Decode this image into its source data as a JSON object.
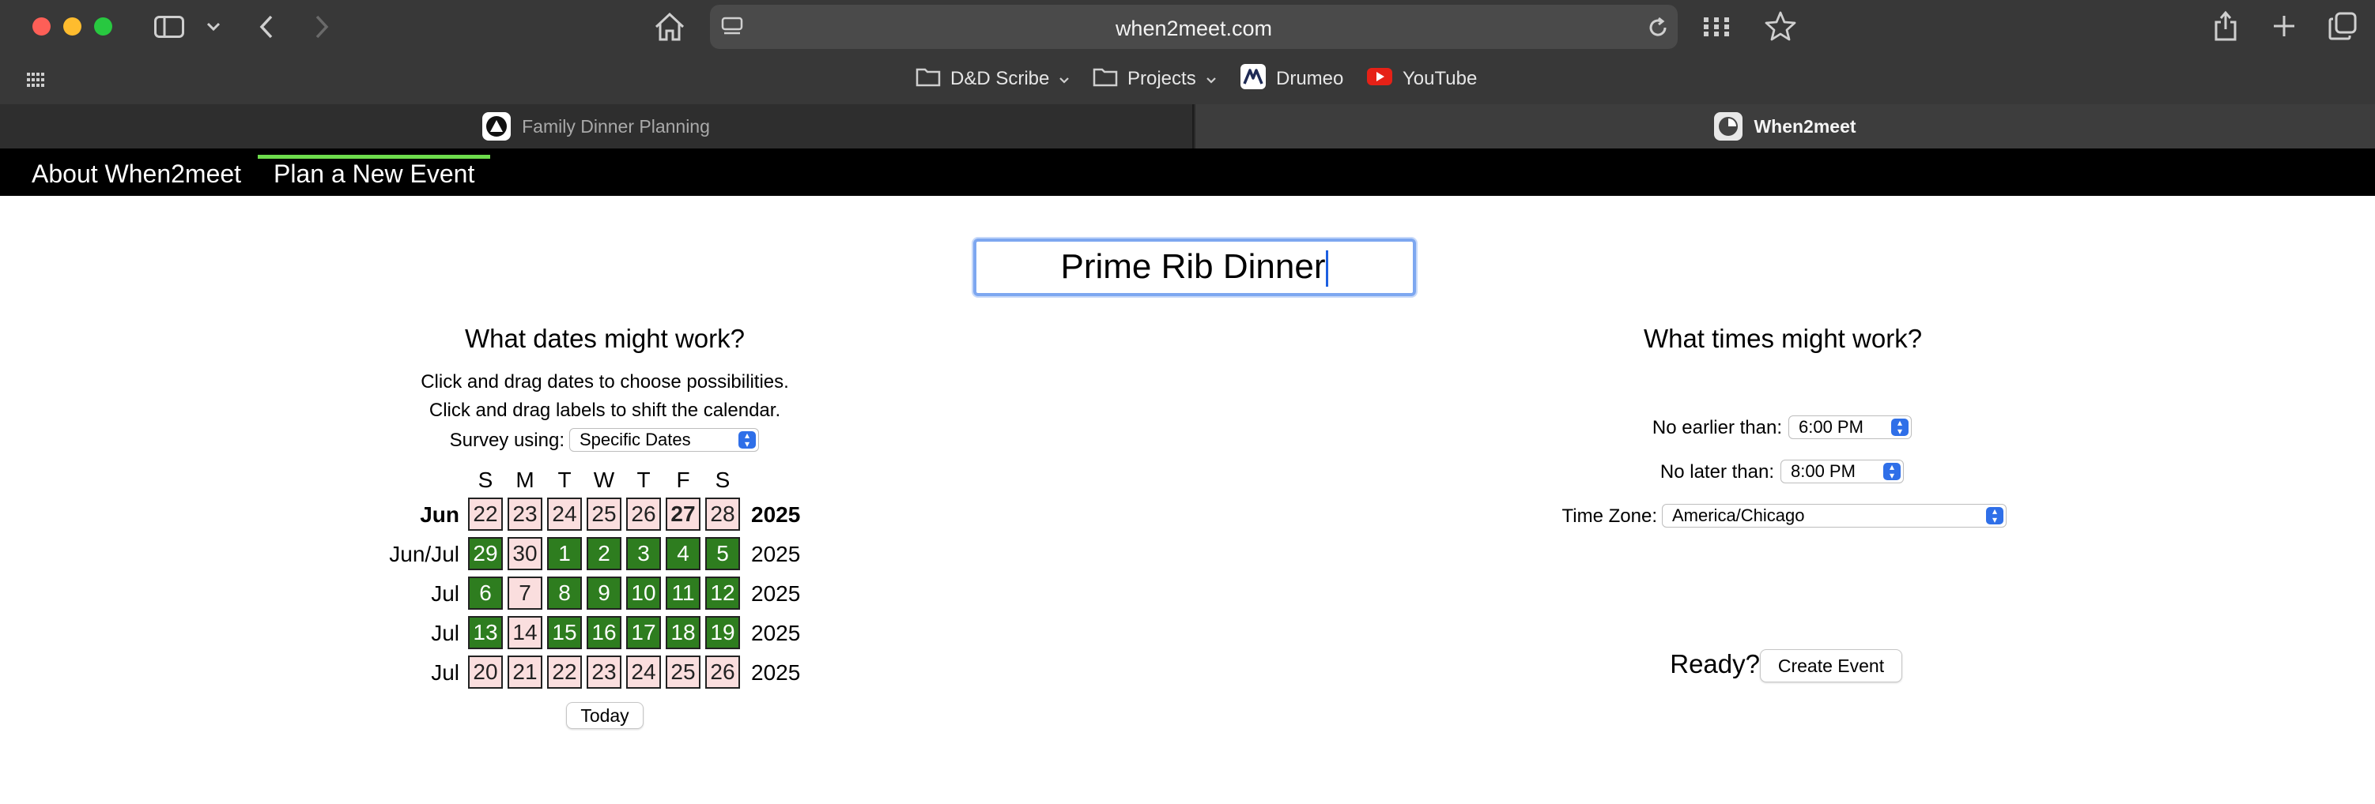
{
  "browser": {
    "url": "when2meet.com",
    "favorites": [
      {
        "label": "D&D Scribe",
        "icon": "folder-icon"
      },
      {
        "label": "Projects",
        "icon": "folder-icon"
      },
      {
        "label": "Drumeo",
        "icon": "drumeo-icon"
      },
      {
        "label": "YouTube",
        "icon": "youtube-icon"
      }
    ],
    "tabs": [
      {
        "label": "Family Dinner Planning",
        "active": false
      },
      {
        "label": "When2meet",
        "active": true
      }
    ]
  },
  "site_nav": {
    "about": "About When2meet",
    "plan": "Plan a New Event"
  },
  "event": {
    "name": "Prime Rib Dinner"
  },
  "dates_panel": {
    "heading": "What dates might work?",
    "instruction_1": "Click and drag dates to choose possibilities.",
    "instruction_2": "Click and drag labels to shift the calendar.",
    "survey_label": "Survey using:",
    "survey_value": "Specific Dates",
    "weekdays": [
      "S",
      "M",
      "T",
      "W",
      "T",
      "F",
      "S"
    ],
    "today_button": "Today",
    "rows": [
      {
        "label": "Jun",
        "year": "2025",
        "bold": true,
        "days": [
          {
            "d": "22",
            "sel": false
          },
          {
            "d": "23",
            "sel": false
          },
          {
            "d": "24",
            "sel": false
          },
          {
            "d": "25",
            "sel": false
          },
          {
            "d": "26",
            "sel": false
          },
          {
            "d": "27",
            "sel": false,
            "today": true
          },
          {
            "d": "28",
            "sel": false
          }
        ]
      },
      {
        "label": "Jun/Jul",
        "year": "2025",
        "bold": false,
        "days": [
          {
            "d": "29",
            "sel": true
          },
          {
            "d": "30",
            "sel": false
          },
          {
            "d": "1",
            "sel": true
          },
          {
            "d": "2",
            "sel": true
          },
          {
            "d": "3",
            "sel": true
          },
          {
            "d": "4",
            "sel": true
          },
          {
            "d": "5",
            "sel": true
          }
        ]
      },
      {
        "label": "Jul",
        "year": "2025",
        "bold": false,
        "days": [
          {
            "d": "6",
            "sel": true
          },
          {
            "d": "7",
            "sel": false
          },
          {
            "d": "8",
            "sel": true
          },
          {
            "d": "9",
            "sel": true
          },
          {
            "d": "10",
            "sel": true
          },
          {
            "d": "11",
            "sel": true
          },
          {
            "d": "12",
            "sel": true
          }
        ]
      },
      {
        "label": "Jul",
        "year": "2025",
        "bold": false,
        "days": [
          {
            "d": "13",
            "sel": true
          },
          {
            "d": "14",
            "sel": false
          },
          {
            "d": "15",
            "sel": true
          },
          {
            "d": "16",
            "sel": true
          },
          {
            "d": "17",
            "sel": true
          },
          {
            "d": "18",
            "sel": true
          },
          {
            "d": "19",
            "sel": true
          }
        ]
      },
      {
        "label": "Jul",
        "year": "2025",
        "bold": false,
        "days": [
          {
            "d": "20",
            "sel": false
          },
          {
            "d": "21",
            "sel": false
          },
          {
            "d": "22",
            "sel": false
          },
          {
            "d": "23",
            "sel": false
          },
          {
            "d": "24",
            "sel": false
          },
          {
            "d": "25",
            "sel": false
          },
          {
            "d": "26",
            "sel": false
          }
        ]
      }
    ]
  },
  "times_panel": {
    "heading": "What times might work?",
    "earliest_label": "No earlier than:",
    "earliest_value": "6:00 PM",
    "latest_label": "No later than:",
    "latest_value": "8:00 PM",
    "timezone_label": "Time Zone:",
    "timezone_value": "America/Chicago",
    "ready_label": "Ready?",
    "create_button": "Create Event"
  },
  "colors": {
    "selected_date": "#2e7d1f",
    "unselected_date": "#fadede",
    "nav_active_bar": "#6ddc4c",
    "input_focus": "#7da7f0"
  }
}
